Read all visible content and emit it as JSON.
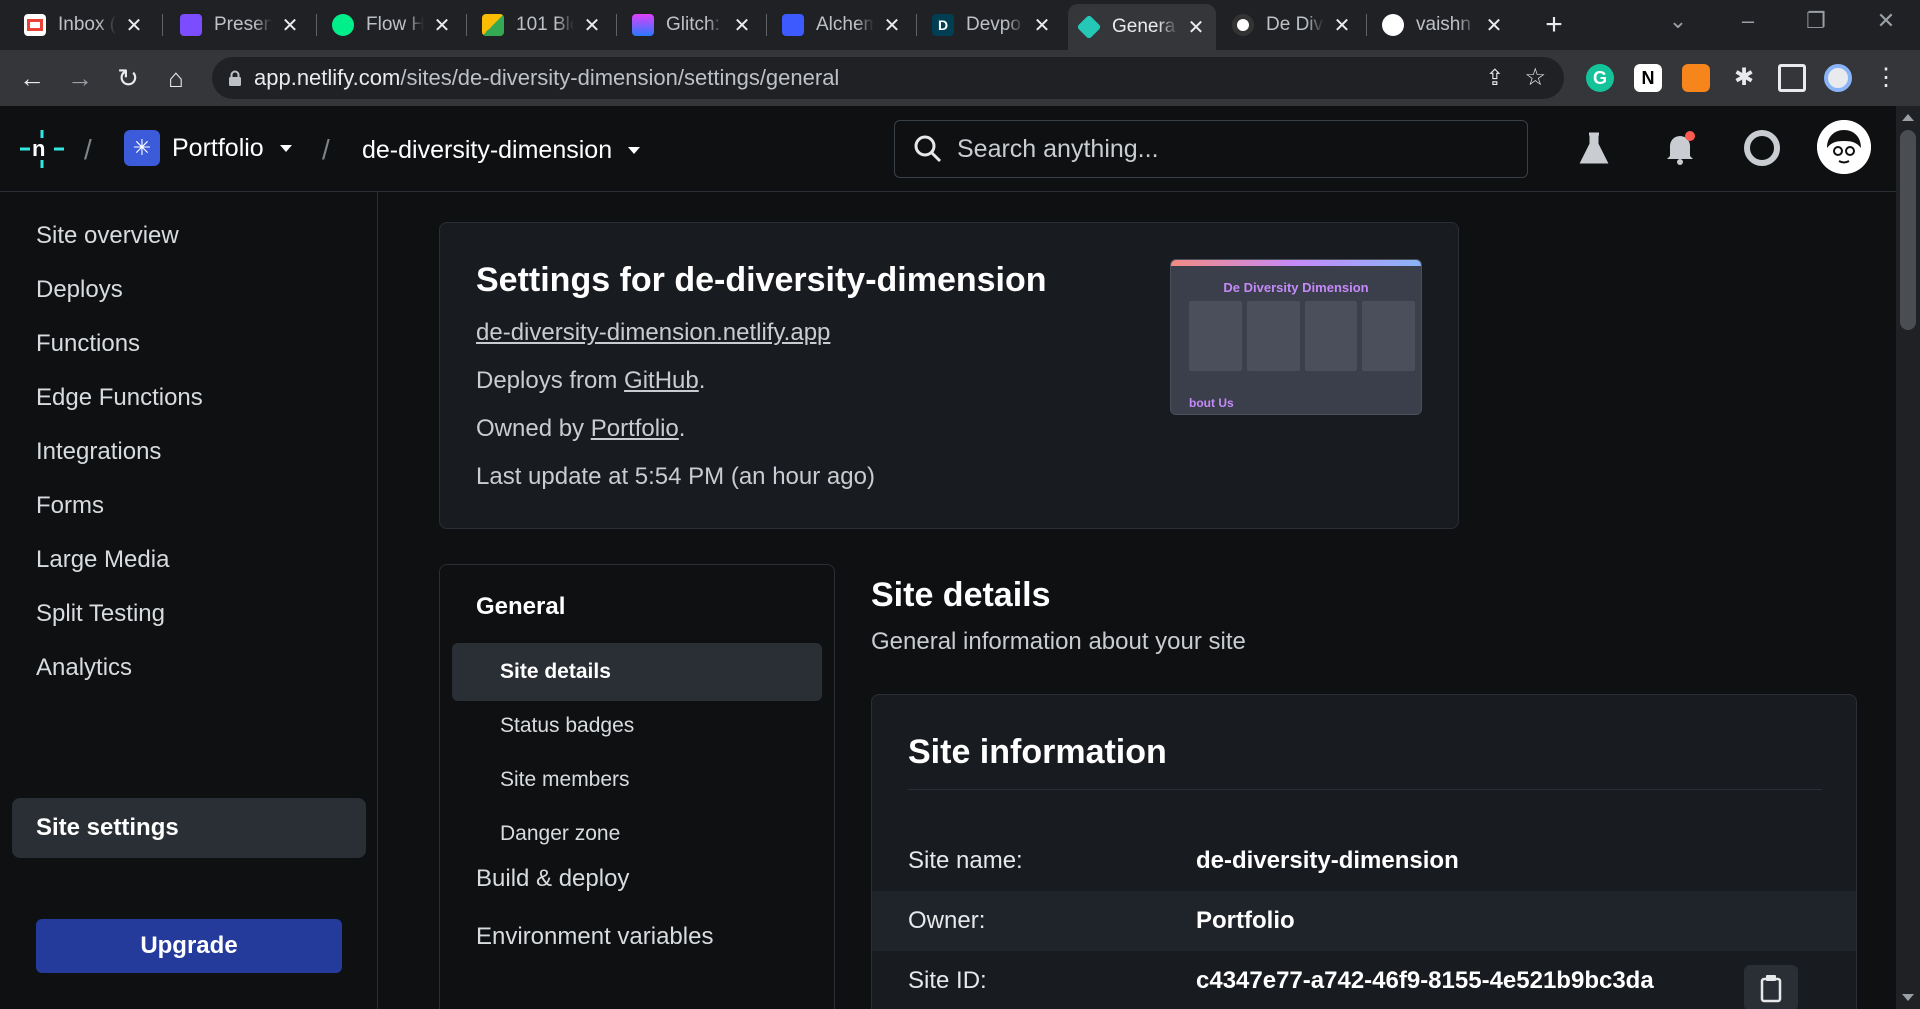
{
  "browser": {
    "tabs": [
      {
        "title": "Inbox (",
        "icon": "gmail-icon",
        "color": "#ea4335"
      },
      {
        "title": "Presen",
        "icon": "presentation-icon",
        "color": "#7c4dff"
      },
      {
        "title": "Flow H",
        "icon": "flow-icon",
        "color": "#00ef8b"
      },
      {
        "title": "101 Blo",
        "icon": "blocks-icon",
        "color": "#fbbc04"
      },
      {
        "title": "Glitch:",
        "icon": "glitch-icon",
        "color": "#e040fb"
      },
      {
        "title": "Alchem",
        "icon": "alchemy-icon",
        "color": "#3d5afe"
      },
      {
        "title": "Devpo",
        "icon": "devpost-icon",
        "color": "#003e54"
      },
      {
        "title": "Genera",
        "icon": "netlify-icon",
        "color": "#25c7b7",
        "active": true
      },
      {
        "title": "De Div",
        "icon": "site-icon",
        "color": "#ffffff"
      },
      {
        "title": "vaishn",
        "icon": "github-icon",
        "color": "#ffffff"
      }
    ],
    "url_domain": "app.netlify.com",
    "url_path": "/sites/de-diversity-dimension/settings/general"
  },
  "header": {
    "team": "Portfolio",
    "site": "de-diversity-dimension",
    "search_placeholder": "Search anything..."
  },
  "sidebar": {
    "items": [
      {
        "label": "Site overview"
      },
      {
        "label": "Deploys"
      },
      {
        "label": "Functions"
      },
      {
        "label": "Edge Functions"
      },
      {
        "label": "Integrations"
      },
      {
        "label": "Forms"
      },
      {
        "label": "Large Media"
      },
      {
        "label": "Split Testing"
      },
      {
        "label": "Analytics"
      },
      {
        "label": "Site settings",
        "active": true
      }
    ],
    "upgrade": "Upgrade"
  },
  "summary": {
    "title": "Settings for de-diversity-dimension",
    "site_url": "de-diversity-dimension.netlify.app",
    "deploys_prefix": "Deploys from ",
    "deploys_link": "GitHub",
    "owned_prefix": "Owned by ",
    "owned_link": "Portfolio",
    "period": ".",
    "last_update": "Last update at 5:54 PM (an hour ago)",
    "thumb_heading": "De Diversity Dimension",
    "thumb_about": "bout Us"
  },
  "subnav": {
    "general": "General",
    "items": [
      "Site details",
      "Status badges",
      "Site members",
      "Danger zone"
    ],
    "build_deploy": "Build & deploy",
    "env_vars": "Environment variables"
  },
  "details": {
    "title": "Site details",
    "subtitle": "General information about your site",
    "card_title": "Site information",
    "rows": [
      {
        "key": "Site name:",
        "value": "de-diversity-dimension"
      },
      {
        "key": "Owner:",
        "value": "Portfolio"
      },
      {
        "key": "Site ID:",
        "value": "c4347e77-a742-46f9-8155-4e521b9bc3da"
      }
    ]
  }
}
